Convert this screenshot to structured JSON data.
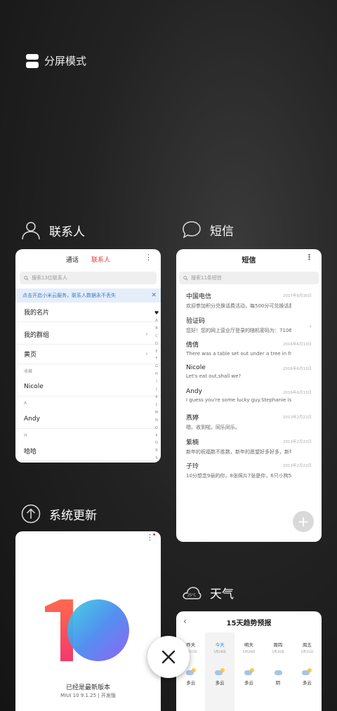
{
  "split_mode": {
    "label": "分屏模式"
  },
  "apps": {
    "contacts": {
      "name": "联系人",
      "tabs": [
        "通话",
        "联系人"
      ],
      "search_placeholder": "搜索13位联系人",
      "banner": "点击开启小米云服务，联系人数据永不丢失",
      "rows": {
        "my_card": "我的名片",
        "my_groups": "我的群组",
        "yellow_pages": "黄页",
        "section_fav": "收藏",
        "nicole": "Nicole",
        "section_a": "A",
        "andy": "Andy",
        "section_h": "H",
        "haha": "哈哈"
      },
      "alphabet": [
        "♥",
        "A",
        "B",
        "C",
        "D",
        "E",
        "F",
        "G",
        "H",
        "I",
        "J",
        "K",
        "L",
        "M",
        "N",
        "O",
        "P",
        "Q",
        "R",
        "S"
      ]
    },
    "sms": {
      "name": "短信",
      "title": "短信",
      "search_placeholder": "搜索11条短信",
      "messages": [
        {
          "sender": "中国电信",
          "preview": "欢迎参加积分兑换话费活动，每500分可兑换话费…",
          "date": "2017年8月30日"
        },
        {
          "sender": "验证码",
          "preview": "您好！您的网上营业厅登录的随机密码为：71067…",
          "date": ""
        },
        {
          "sender": "倩倩",
          "preview": "There was a table set out under a tree in front o…",
          "date": "2016年6月13日"
        },
        {
          "sender": "Nicole",
          "preview": "Let's eat out,shall we?",
          "date": "2016年6月13日"
        },
        {
          "sender": "Andy",
          "preview": "I guess you're some lucky guy.Stephanie is a n…",
          "date": "2016年6月13日"
        },
        {
          "sender": "燕婷",
          "preview": "嗯。收到啦。同乐同乐。",
          "date": "2013年2月22日"
        },
        {
          "sender": "紫楠",
          "preview": "新年的祝福数不胜数，新年的愿望好多好多，新年…",
          "date": "2013年2月22日"
        },
        {
          "sender": "子玲",
          "preview": "10分想念9丽的你，8张照片7张是你，6只小狗5只…",
          "date": "2013年2月22日"
        }
      ]
    },
    "updater": {
      "name": "系统更新",
      "status": "已经是最新版本",
      "version": "MIUI 10 9.1.25 | 开发版"
    },
    "weather": {
      "name": "天气",
      "icon_text": "25°C",
      "title": "15天趋势预报",
      "days": [
        {
          "name": "昨天",
          "date": "5月27日",
          "cond": "多云"
        },
        {
          "name": "今天",
          "date": "5月28日",
          "cond": "多云"
        },
        {
          "name": "明天",
          "date": "5月29日",
          "cond": "多云"
        },
        {
          "name": "周四",
          "date": "5月30日",
          "cond": "阴"
        },
        {
          "name": "周五",
          "date": "5月31日",
          "cond": "多云"
        }
      ]
    }
  },
  "colors": {
    "accent_red": "#e53935",
    "banner_blue": "#3c77c9",
    "today_blue": "#1e88e5"
  }
}
